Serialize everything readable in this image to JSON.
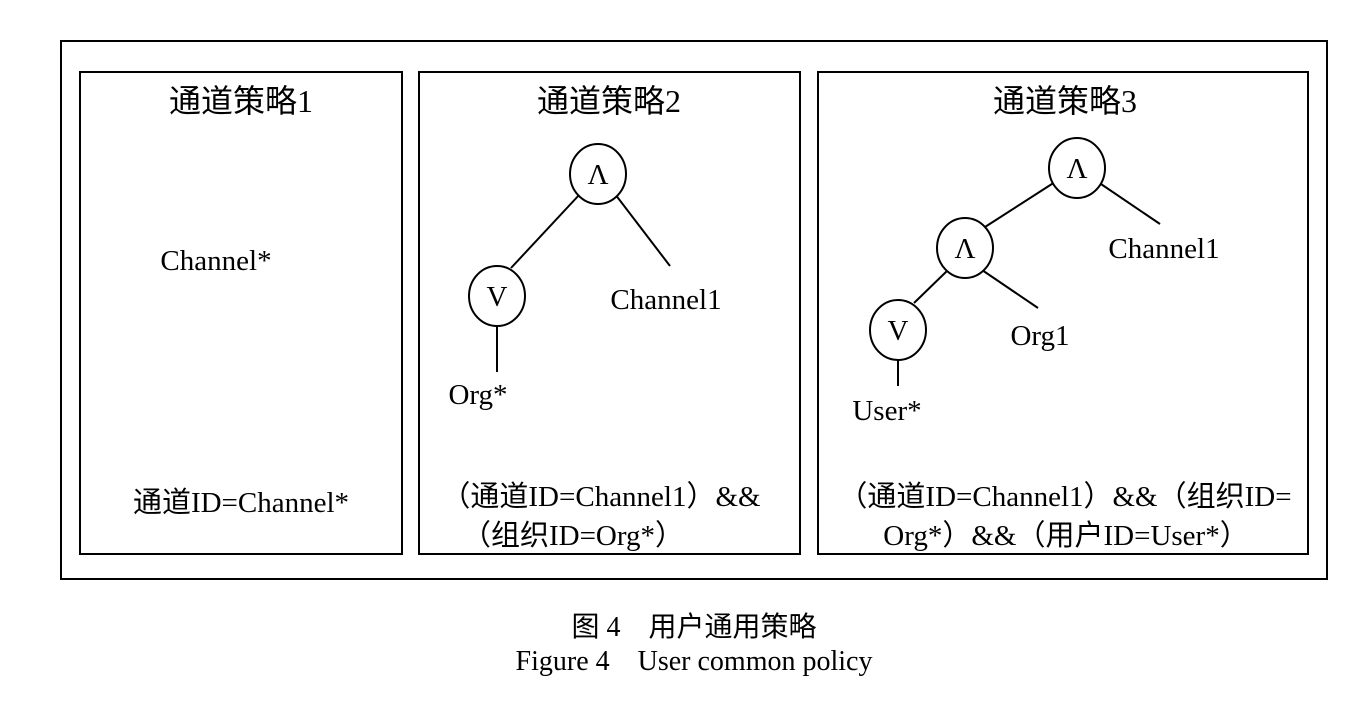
{
  "panel1": {
    "title": "通道策略1",
    "leaf": "Channel*",
    "expression": "通道ID=Channel*"
  },
  "panel2": {
    "title": "通道策略2",
    "root_symbol": "Λ",
    "child_symbol": "V",
    "leaf_right": "Channel1",
    "leaf_bottom": "Org*",
    "expression_line1": "（通道ID=Channel1）&&",
    "expression_line2": "（组织ID=Org*）"
  },
  "panel3": {
    "title": "通道策略3",
    "root_symbol": "Λ",
    "mid_symbol": "Λ",
    "low_symbol": "V",
    "leaf_channel": "Channel1",
    "leaf_org": "Org1",
    "leaf_user": "User*",
    "expression_line1": "（通道ID=Channel1）&&（组织ID=",
    "expression_line2": "Org*）&&（用户ID=User*）"
  },
  "caption": {
    "cn": "图 4　用户通用策略",
    "en": "Figure 4　User common policy"
  }
}
